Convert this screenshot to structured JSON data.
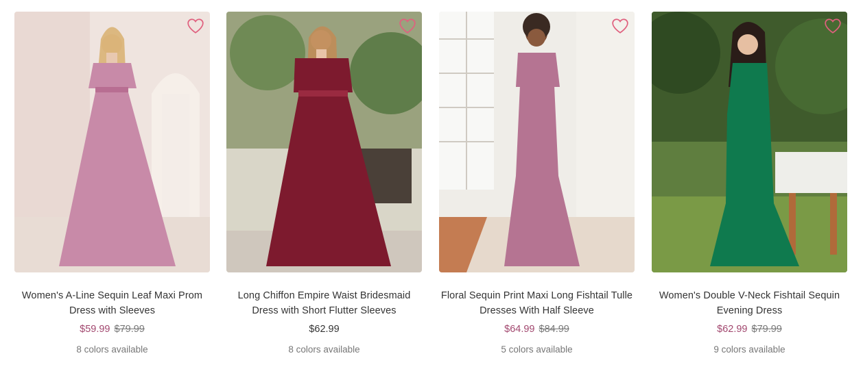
{
  "products": [
    {
      "title": "Women's A-Line Sequin Leaf Maxi Prom Dress with Sleeves",
      "price": "$59.99",
      "original_price": "$79.99",
      "colors_text": "8 colors available",
      "dress_color": "#c88aa8",
      "on_sale": true,
      "wishlist_icon": "heart-outline-icon"
    },
    {
      "title": "Long Chiffon Empire Waist Bridesmaid Dress with Short Flutter Sleeves",
      "price": "$62.99",
      "original_price": "",
      "colors_text": "8 colors available",
      "dress_color": "#7d1a2e",
      "on_sale": false,
      "wishlist_icon": "heart-outline-icon"
    },
    {
      "title": "Floral Sequin Print Maxi Long Fishtail Tulle Dresses With Half Sleeve",
      "price": "$64.99",
      "original_price": "$84.99",
      "colors_text": "5 colors available",
      "dress_color": "#b57492",
      "on_sale": true,
      "wishlist_icon": "heart-outline-icon"
    },
    {
      "title": "Women's Double V-Neck Fishtail Sequin Evening Dress",
      "price": "$62.99",
      "original_price": "$79.99",
      "colors_text": "9 colors available",
      "dress_color": "#0f7a4e",
      "on_sale": true,
      "wishlist_icon": "heart-outline-icon"
    }
  ],
  "theme": {
    "sale_price_color": "#a2486f",
    "heart_color": "#e0607e"
  }
}
